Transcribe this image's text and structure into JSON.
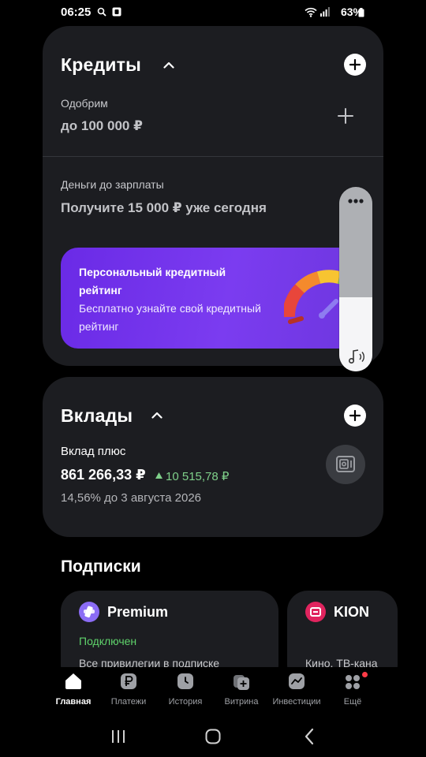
{
  "status_bar": {
    "time": "06:25",
    "battery": "63%"
  },
  "credits": {
    "title": "Кредиты",
    "approve_label": "Одобрим",
    "approve_value": "до 100 000 ₽",
    "payday_label": "Деньги до зарплаты",
    "payday_value": "Получите 15 000 ₽ уже сегодня",
    "promo": {
      "title": "Персональный кредитный рейтинг",
      "subtitle": "Бесплатно узнайте свой кредитный рейтинг"
    }
  },
  "volume": {
    "level": 0.4
  },
  "deposits": {
    "title": "Вклады",
    "name": "Вклад плюс",
    "amount": "861 266,33 ₽",
    "gain": "10 515,78 ₽",
    "rate": "14,56% до 3 августа 2026"
  },
  "subscriptions": {
    "title": "Подписки",
    "items": [
      {
        "name": "Premium",
        "status": "Подключен",
        "desc": "Все привилегии в подписке",
        "color": "#8b6cf5"
      },
      {
        "name": "KION",
        "desc": "Кино, ТВ-кана",
        "color": "#e0245e"
      }
    ]
  },
  "bottom_nav": {
    "items": [
      {
        "label": "Главная",
        "icon": "home-icon"
      },
      {
        "label": "Платежи",
        "icon": "ruble-icon"
      },
      {
        "label": "История",
        "icon": "clock-icon"
      },
      {
        "label": "Витрина",
        "icon": "showcase-icon"
      },
      {
        "label": "Инвестиции",
        "icon": "chart-icon"
      },
      {
        "label": "Ещё",
        "icon": "apps-icon"
      }
    ]
  },
  "colors": {
    "background": "#000000",
    "card": "#1c1d21",
    "accent_purple": "#7b3cf0",
    "gain_green": "#7fd08a"
  }
}
